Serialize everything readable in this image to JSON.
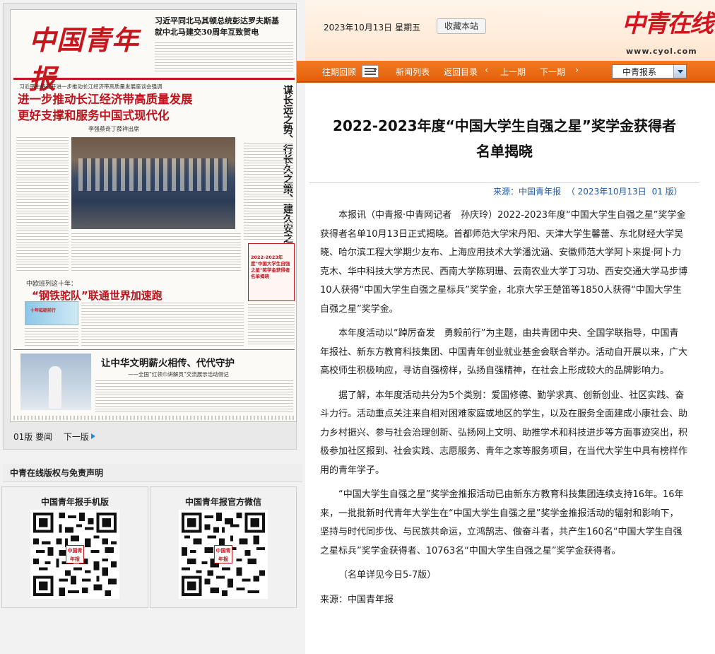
{
  "left_panel": {
    "newspaper": {
      "masthead": "中国青年报",
      "top_headline_1": "习近平同北马其顿总统彭达罗夫斯基",
      "top_headline_2": "就中北马建交30周年互致贺电",
      "lead_kicker": "习近平主持召开进一步推动长江经济带高质量发展座谈会强调",
      "lead_title_1": "进一步推动长江经济带高质量发展",
      "lead_title_2": "更好支撑和服务中国式现代化",
      "lead_sub": "李强蔡奇丁薛祥出席",
      "vertical_headline": "谋长远之势、行长久之策、建久安之基",
      "side_box": "2022-2023年度\"中国大学生自强之星\"奖学金获得者名单揭晓",
      "sec2_kicker": "中欧班列这十年：",
      "sec2_title": "“钢铁驼队”联通世界加速跑",
      "sec2_img_label": "十年砥砺前行",
      "sec3_title": "让中华文明薪火相传、代代守护",
      "sec3_sub": "——全国“红领巾讲解员”交流展示活动侧记"
    },
    "pager": {
      "current": "01版 要闻",
      "next": "下一版"
    },
    "copyright": "中青在线版权与免责声明",
    "qr_mobile": {
      "title": "中国青年报手机版",
      "logo": "中国青年报"
    },
    "qr_wechat": {
      "title": "中国青年报官方微信",
      "logo": "中国青年报"
    }
  },
  "topbar": {
    "date": "2023年10月13日",
    "weekday": "星期五",
    "bookmark": "收藏本站",
    "logo_text": "中青在线",
    "logo_url": "www.cyol.com"
  },
  "nav": {
    "back_issues": "往期回顾",
    "news_list": "新闻列表",
    "back_catalog": "返回目录",
    "prev_page": "上一期",
    "next_page": "下一期",
    "selected": "中青报系",
    "chev_left": "‹",
    "chev_right": "›"
  },
  "article": {
    "title_1": "2022-2023年度“中国大学生自强之星”奖学金获得者",
    "title_2": "名单揭晓",
    "source_label": "来源：中国青年报",
    "source_date": "（ 2023年10月13日",
    "source_page": "01 版）",
    "paragraphs": [
      "本报讯（中青报·中青网记者　孙庆玲）2022-2023年度“中国大学生自强之星”奖学金获得者名单10月13日正式揭晓。首都师范大学宋丹阳、天津大学生馨蕾、东北财经大学吴晓、哈尔滨工程大学期少友布、上海应用技术大学潘沈涵、安徽师范大学阿卜来提·阿卜力克木、华中科技大学方杰民、西南大学陈玥珊、云南农业大学丁习功、西安交通大学马步博10人获得“中国大学生自强之星标兵”奖学金，北京大学王楚笛等1850人获得“中国大学生自强之星”奖学金。",
      "本年度活动以“踔厉奋发　勇毅前行”为主题，由共青团中央、全国学联指导，中国青年报社、新东方教育科技集团、中国青年创业就业基金会联合举办。活动自开展以来，广大高校师生积极响应，寻访自强榜样，弘扬自强精神，在社会上形成较大的品牌影响力。",
      "据了解，本年度活动共分为5个类别：爱国修德、勤学求真、创新创业、社区实践、奋斗力行。活动重点关注来自相对困难家庭或地区的学生，以及在服务全面建成小康社会、助力乡村振兴、参与社会治理创新、弘扬网上文明、助推学术和科技进步等方面事迹突出，积极参加社区报到、社会实践、志愿服务、青年之家等服务项目，在当代大学生中具有榜样作用的青年学子。",
      "“中国大学生自强之星”奖学金推报活动已由新东方教育科技集团连续支持16年。16年来，一批批新时代青年大学生在“中国大学生自强之星”奖学金推报活动的辐射和影响下，坚持与时代同步伐、与民族共命运，立鸿鹄志、做奋斗者，共产生160名“中国大学生自强之星标兵”奖学金获得者、10763名“中国大学生自强之星”奖学金获得者。",
      "（名单详见今日5-7版）"
    ],
    "footer_source": "来源：中国青年报"
  }
}
